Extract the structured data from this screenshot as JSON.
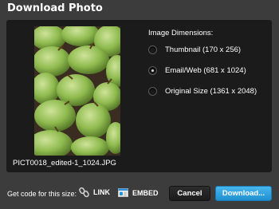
{
  "dialog": {
    "title": "Download Photo"
  },
  "photo": {
    "filename": "PICT0018_edited-1_1024.JPG"
  },
  "dimensions": {
    "heading": "Image Dimensions:",
    "options": [
      {
        "label": "Thumbnail (170 x 256)",
        "selected": false
      },
      {
        "label": "Email/Web (681 x 1024)",
        "selected": true
      },
      {
        "label": "Original Size (1361 x 2048)",
        "selected": false
      }
    ]
  },
  "footer": {
    "get_code_label": "Get code for this size:",
    "link_label": "LINK",
    "link_icon": "chain-link-icon",
    "embed_label": "EMBED",
    "embed_icon": "embed-window-icon",
    "cancel_label": "Cancel",
    "download_label": "Download..."
  },
  "colors": {
    "accent": "#2aa3e4",
    "background": "#3c3c3c",
    "panel": "#1b1b1b"
  }
}
